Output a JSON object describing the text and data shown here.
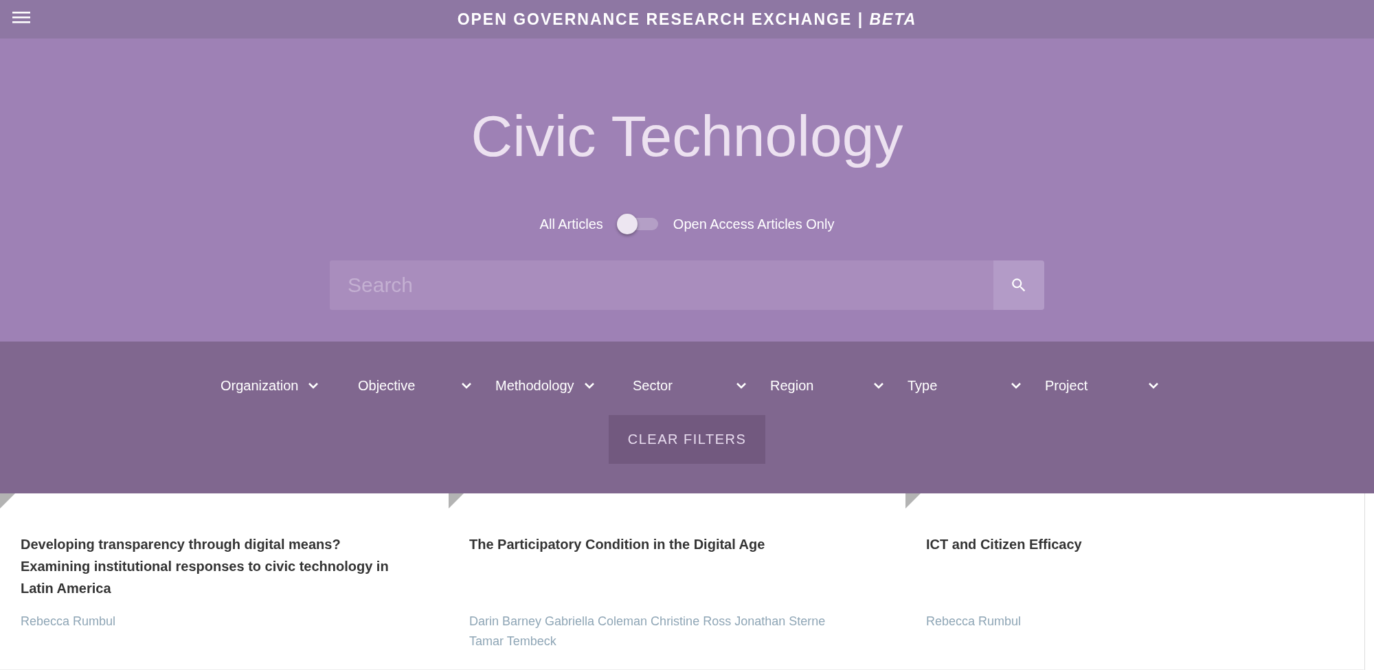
{
  "header": {
    "title": "OPEN GOVERNANCE RESEARCH EXCHANGE | *BETA*"
  },
  "hero": {
    "title": "Civic Technology",
    "toggle": {
      "left_label": "All Articles",
      "right_label": "Open Access Articles Only",
      "on": false
    },
    "search": {
      "placeholder": "Search"
    }
  },
  "filters": {
    "dropdowns": [
      {
        "label": "Organization"
      },
      {
        "label": "Objective"
      },
      {
        "label": "Methodology"
      },
      {
        "label": "Sector"
      },
      {
        "label": "Region"
      },
      {
        "label": "Type"
      },
      {
        "label": "Project"
      }
    ],
    "clear_button": "CLEAR FILTERS"
  },
  "articles": [
    {
      "title": "Developing transparency through digital means? Examining institutional responses to civic technology in Latin America",
      "authors": "Rebecca Rumbul"
    },
    {
      "title": "The Participatory Condition in the Digital Age",
      "authors": "Darin Barney Gabriella Coleman Christine Ross Jonathan Sterne Tamar Tembeck"
    },
    {
      "title": "ICT and Citizen Efficacy",
      "authors": "Rebecca Rumbul"
    }
  ]
}
